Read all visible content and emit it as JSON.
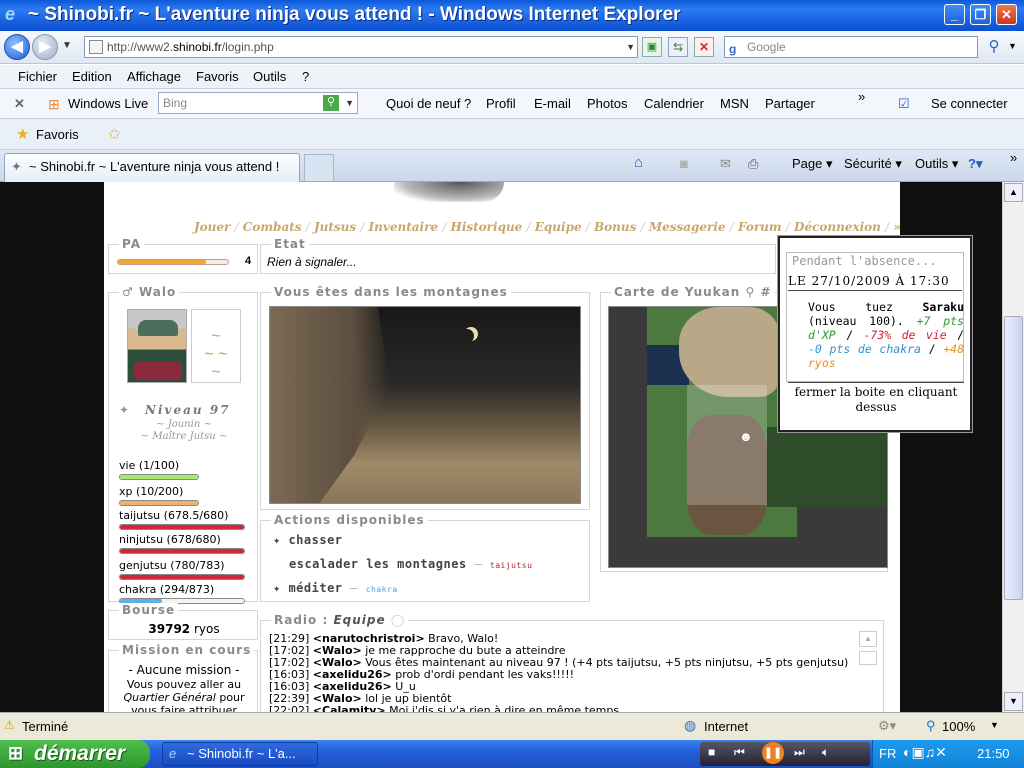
{
  "window": {
    "title": "~ Shinobi.fr ~ L'aventure ninja vous attend ! - Windows Internet Explorer"
  },
  "address": {
    "prefix": "http://www2.",
    "host": "shinobi.fr",
    "path": "/login.php",
    "search_placeholder": "Google"
  },
  "menu": [
    "Fichier",
    "Edition",
    "Affichage",
    "Favoris",
    "Outils",
    "?"
  ],
  "windows_live": {
    "label": "Windows Live",
    "search_placeholder": "Bing",
    "links": [
      "Quoi de neuf ?",
      "Profil",
      "E-mail",
      "Photos",
      "Calendrier",
      "MSN",
      "Partager"
    ],
    "connect": "Se connecter"
  },
  "favorites": {
    "label": "Favoris"
  },
  "tab": {
    "title": "~ Shinobi.fr ~ L'aventure ninja vous attend !"
  },
  "commandbar": {
    "page": "Page",
    "security": "Sécurité",
    "tools": "Outils"
  },
  "game": {
    "nav": [
      "Jouer",
      "Combats",
      "Jutsus",
      "Inventaire",
      "Historique",
      "Equipe",
      "Bonus",
      "Messagerie",
      "Forum",
      "Déconnexion",
      "»"
    ],
    "pa": {
      "legend": "PA",
      "value": "4",
      "fill": 0.8
    },
    "etat": {
      "legend": "Etat",
      "text": "Rien à signaler..."
    },
    "player": {
      "legend": "Walo",
      "level": "Niveau 97",
      "rank": "~ Jounin ~",
      "title": "~ Maître Jutsu ~"
    },
    "stats": [
      {
        "label": "vie (1/100)",
        "fill": 0.01,
        "color": "#a8e870"
      },
      {
        "label": "xp (10/200)",
        "fill": 0.05,
        "color": "#f0b070"
      },
      {
        "label": "taijutsu (678.5/680)",
        "fill": 0.998,
        "color": "#d02838"
      },
      {
        "label": "ninjutsu (678/680)",
        "fill": 0.997,
        "color": "#d02838"
      },
      {
        "label": "genjutsu (780/783)",
        "fill": 0.996,
        "color": "#d02838"
      },
      {
        "label": "chakra (294/873)",
        "fill": 0.337,
        "color": "#60b0e8"
      }
    ],
    "location": {
      "legend": "Vous êtes dans les montagnes"
    },
    "map": {
      "legend": "Carte de Yuukan"
    },
    "actions": {
      "legend": "Actions disponibles",
      "items": [
        {
          "label": "chasser",
          "tag": ""
        },
        {
          "label": "escalader les montagnes",
          "tag": "taijutsu"
        },
        {
          "label": "méditer",
          "tag": "chakra"
        }
      ]
    },
    "bourse": {
      "legend": "Bourse",
      "amount": "39792",
      "unit": "ryos"
    },
    "mission": {
      "legend": "Mission en cours",
      "line1": "- Aucune mission -",
      "line2": "Vous pouvez aller au",
      "line3a": "Quartier Général",
      "line3b": " pour",
      "line4": "vous faire attribuer"
    },
    "radio": {
      "legend": "Radio :",
      "channel": "Equipe",
      "messages": [
        {
          "time": "[21:29]",
          "user": "<narutochristroi>",
          "text": "Bravo, Walo!"
        },
        {
          "time": "[17:02]",
          "user": "<Walo>",
          "text": "je me rapproche du bute a atteindre"
        },
        {
          "time": "[17:02]",
          "user": "<Walo>",
          "text": "Vous êtes maintenant au niveau 97 ! (+4 pts taijutsu, +5 pts ninjutsu, +5 pts genjutsu)"
        },
        {
          "time": "[16:03]",
          "user": "<axelidu26>",
          "text": "prob d'ordi pendant les vaks!!!!!"
        },
        {
          "time": "[16:03]",
          "user": "<axelidu26>",
          "text": "U_u"
        },
        {
          "time": "[22:39]",
          "user": "<Walo>",
          "text": "lol je up bientôt"
        },
        {
          "time": "[22:02]",
          "user": "<Calamity>",
          "text": "Moi j'dis si y'a rien à dire en même temps..."
        }
      ]
    },
    "popup": {
      "legend": "Pendant l'absence...",
      "date_le": "LE",
      "date": "27/10/2009 À 17:30",
      "t1": "Vous tuez",
      "t2": "Saraku",
      "t3": "(niveau 100).",
      "xp": "+7 pts d'XP",
      "vie": "-73% de vie",
      "chakra": "-0 pts de chakra",
      "ryos": "+48 ryos",
      "close": "fermer la boite en cliquant dessus"
    }
  },
  "status": {
    "text": "Terminé",
    "zone": "Internet",
    "zoom": "100%"
  },
  "taskbar": {
    "start": "démarrer",
    "task": "~ Shinobi.fr ~ L'a...",
    "lang": "FR",
    "clock": "21:50"
  }
}
